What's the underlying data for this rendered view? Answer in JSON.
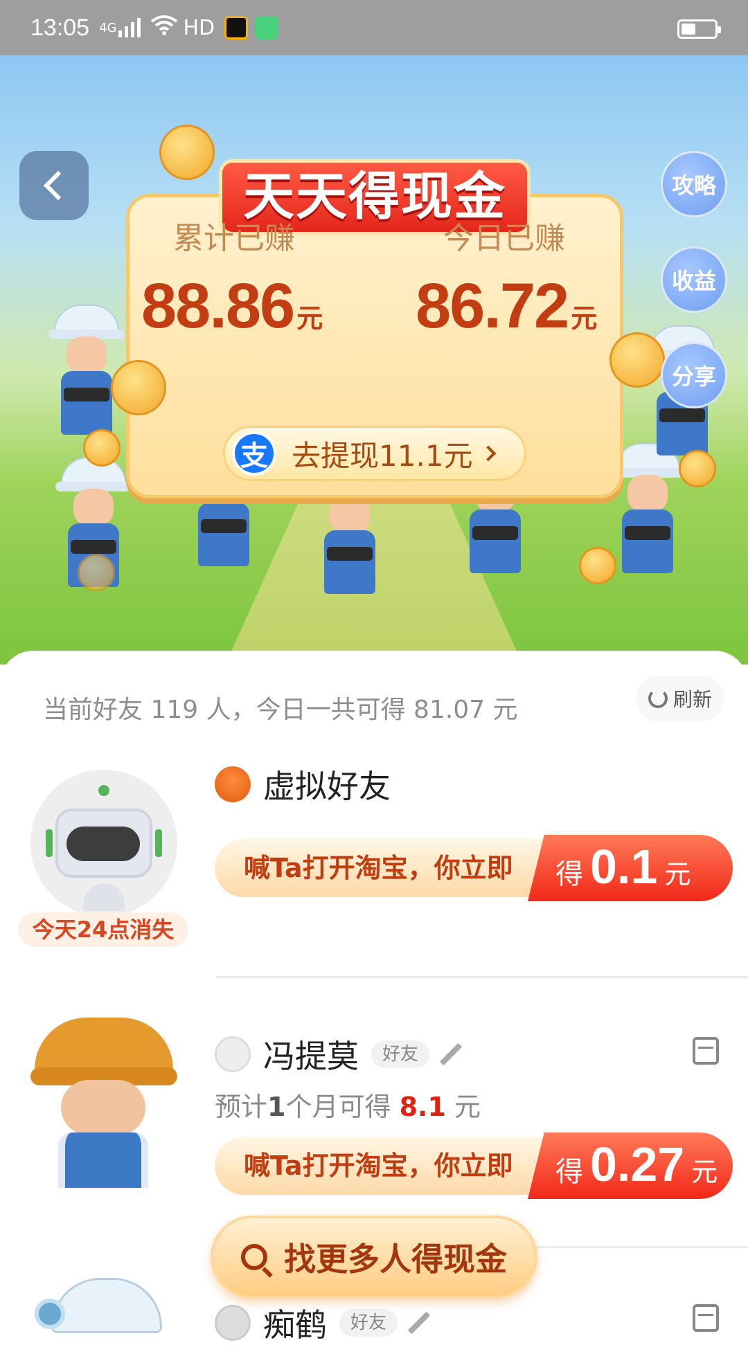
{
  "status_bar": {
    "time": "13:05",
    "network": "4G",
    "hd": "HD"
  },
  "hero": {
    "title": "天天得现金",
    "side_buttons": [
      "攻略",
      "收益",
      "分享"
    ],
    "cumulative_label": "累计已赚",
    "cumulative_value": "88.86",
    "today_label": "今日已赚",
    "today_value": "86.72",
    "unit": "元",
    "alipay_glyph": "支",
    "withdraw_label": "去提现11.1元"
  },
  "friends_summary": "当前好友 119 人，今日一共可得 81.07 元",
  "refresh_label": "刷新",
  "friends": [
    {
      "name": "虚拟好友",
      "badge": "今天24点消失",
      "cta_text": "喊Ta打开淘宝，你立即",
      "cta_prefix": "得",
      "cta_value": "0.1",
      "cta_unit": "元"
    },
    {
      "name": "冯提莫",
      "tag": "好友",
      "estimate_prefix": "预计",
      "estimate_bold": "1",
      "estimate_mid": "个月可得",
      "estimate_value": "8.1",
      "estimate_unit": "元",
      "cta_text": "喊Ta打开淘宝，你立即",
      "cta_prefix": "得",
      "cta_value": "0.27",
      "cta_unit": "元"
    },
    {
      "name": "痴鹤",
      "tag": "好友"
    }
  ],
  "find_more_label": "找更多人得现金",
  "colors": {
    "accent": "#f2281a",
    "brand_orange": "#c13d10",
    "highlight": "#e0220f"
  }
}
